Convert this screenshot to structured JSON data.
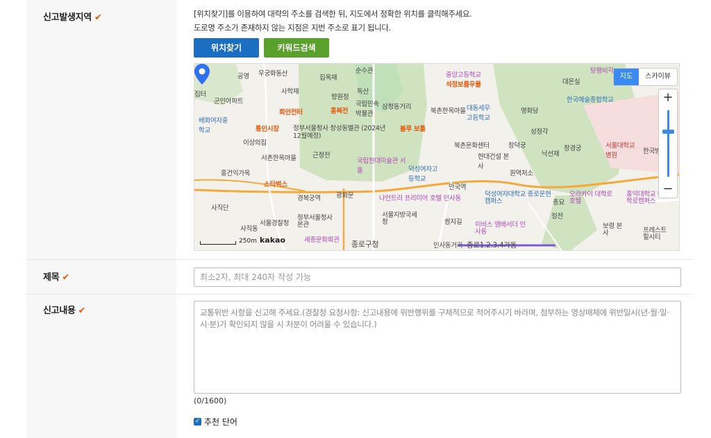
{
  "location": {
    "label": "신고발생지역",
    "desc_line1": "[위치찾기]를 이용하여 대략의 주소를 검색한 뒤, 지도에서 정확한 위치를 클릭해주세요.",
    "desc_line2": "도로명 주소가 존재하지 않는 지점은 지번 주소로 표기 됩니다.",
    "btn_find": "위치찾기",
    "btn_keyword": "키워드검색"
  },
  "map": {
    "type_map": "지도",
    "type_sky": "스카이뷰",
    "zoom_in": "+",
    "zoom_out": "−",
    "scale": "250m",
    "logo": "kakao",
    "labels": [
      "우궁화동산",
      "순수관",
      "중앙고등학교",
      "탕평비각",
      "공영",
      "집옥재",
      "석정보름우물",
      "대온실",
      "사학재",
      "향원정",
      "독산",
      "한국예술종합학교",
      "집터",
      "군인아파트",
      "국립민속박물관",
      "삼청동거리",
      "북촌한옥마을",
      "대동세무고등학교",
      "영화당",
      "회안전터",
      "흥복전",
      "배화여자중학교",
      "통인시장",
      "블루 보틀",
      "정부서울청사 창성동별관 (2024년12월예정)",
      "성정각",
      "이상의집",
      "북촌문화센터",
      "창덕궁",
      "낙선재",
      "창경궁",
      "서울대학교병원",
      "한국방",
      "근정전",
      "국립현대미술관 서울",
      "현대건설 본사",
      "서촌한옥마을",
      "홍건익가옥",
      "덕성여자고등학교",
      "원역처소",
      "스타벅스",
      "경복궁역",
      "광화문",
      "안국역",
      "덕성여자대학교 종로운현캠퍼스",
      "오라카이 대학로호텔",
      "홍익대학교 대학로캠퍼스",
      "나인트리 프리미어 호텔 인사동",
      "종묘",
      "사직단",
      "서울경찰청",
      "정부서울청사 본관",
      "서울지방국세청",
      "쌈지길",
      "이비스 앰배서더 인사동",
      "정전",
      "보령 본사",
      "프레스트 힐시티",
      "사직동",
      "세종문화회관",
      "종로구청",
      "인사동거리",
      "종로1.2.3.4가동"
    ]
  },
  "title": {
    "label": "제목",
    "placeholder": "최소2자, 최대 240자 작성 가능"
  },
  "content": {
    "label": "신고내용",
    "placeholder": "교통위반 사항을 신고해 주세요.(경찰청 요청사항: 신고내용에 위반행위를 구체적으로 적어주시기 바라며, 첨부하는 영상매체에 위반일시(년·월·일·시·분)가 확인되지 않을 시 처분이 어려울 수 있습니다.)",
    "counter": "(0/1600)",
    "recommend": "추천 단어"
  },
  "colors": {
    "accent_blue": "#1b6ec2",
    "accent_green": "#5aa02c",
    "required_check": "#e8590c"
  }
}
